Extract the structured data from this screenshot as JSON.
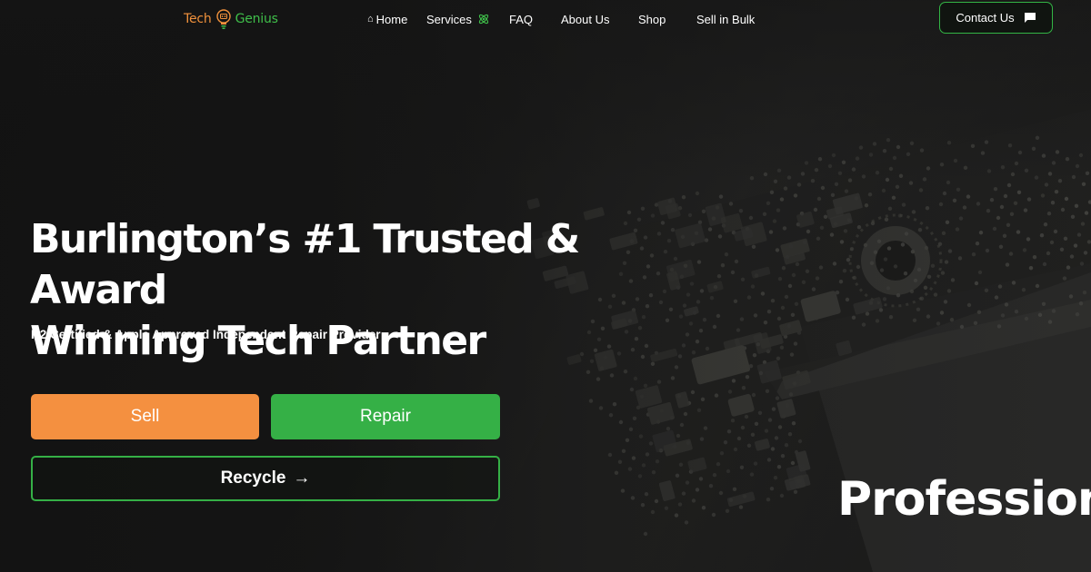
{
  "brand": {
    "word1": "Tech",
    "word2": "Genius",
    "icon": "lightbulb-icon"
  },
  "nav": {
    "items": [
      {
        "label": "Home",
        "icon": "home-icon"
      },
      {
        "label": "Services",
        "icon": "atom-icon"
      },
      {
        "label": "FAQ"
      },
      {
        "label": "About Us"
      },
      {
        "label": "Shop"
      },
      {
        "label": "Sell in Bulk"
      }
    ],
    "home_glyph": "⌂",
    "contact_label": "Contact Us",
    "contact_icon": "chat-bubble-icon"
  },
  "hero": {
    "headline_line1": "Burlington’s #1 Trusted & Award",
    "headline_line2": "Winning Tech Partner",
    "subheadline": "R2 Certified & Apple Approved Independent Repair Provider",
    "sell_label": "Sell",
    "repair_label": "Repair",
    "recycle_label": "Recycle",
    "recycle_arrow": "→",
    "ticker_text": "Professiona"
  },
  "colors": {
    "brand_orange": "#f49040",
    "brand_green": "#35b046",
    "background": "#1a1a1a"
  }
}
